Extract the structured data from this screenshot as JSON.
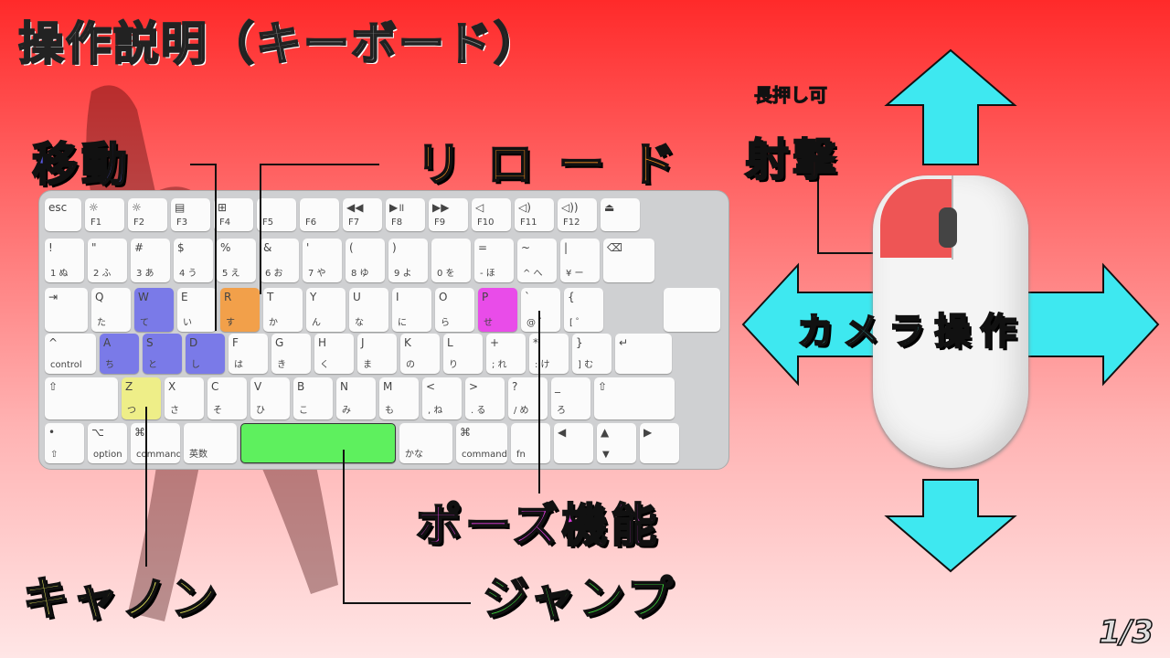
{
  "title": "操作説明（キーボード）",
  "labels": {
    "move": "移動",
    "reload": "リロード",
    "pause": "ポーズ機能",
    "cannon": "キャノン",
    "jump": "ジャンプ",
    "shoot": "射撃",
    "hold": "長押し可",
    "camera": "カメラ操作"
  },
  "page_indicator": "1/3",
  "colors": {
    "move": "#7a7ae8",
    "reload": "#f2a04a",
    "pause": "#e94ce9",
    "cannon": "#eeee88",
    "jump": "#5ef05e",
    "shoot": "#ee5555",
    "camera_arrows": "#3ee8f0"
  },
  "keyboard": {
    "row0": [
      {
        "main": "esc",
        "sub": ""
      },
      {
        "main": "☼",
        "sub": "F1"
      },
      {
        "main": "☼",
        "sub": "F2"
      },
      {
        "main": "▤",
        "sub": "F3"
      },
      {
        "main": "⊞",
        "sub": "F4"
      },
      {
        "main": "",
        "sub": "F5"
      },
      {
        "main": "",
        "sub": "F6"
      },
      {
        "main": "◀◀",
        "sub": "F7"
      },
      {
        "main": "▶॥",
        "sub": "F8"
      },
      {
        "main": "▶▶",
        "sub": "F9"
      },
      {
        "main": "◁",
        "sub": "F10"
      },
      {
        "main": "◁)",
        "sub": "F11"
      },
      {
        "main": "◁))",
        "sub": "F12"
      },
      {
        "main": "⏏",
        "sub": ""
      }
    ],
    "row1": [
      {
        "main": "!",
        "sub": "1 ぬ"
      },
      {
        "main": "\"",
        "sub": "2 ふ"
      },
      {
        "main": "#",
        "sub": "3 あ"
      },
      {
        "main": "$",
        "sub": "4 う"
      },
      {
        "main": "%",
        "sub": "5 え"
      },
      {
        "main": "&",
        "sub": "6 お"
      },
      {
        "main": "'",
        "sub": "7 や"
      },
      {
        "main": "(",
        "sub": "8 ゆ"
      },
      {
        "main": ")",
        "sub": "9 よ"
      },
      {
        "main": "",
        "sub": "0 を"
      },
      {
        "main": "=",
        "sub": "- ほ"
      },
      {
        "main": "~",
        "sub": "^ へ"
      },
      {
        "main": "|",
        "sub": "¥ ー"
      },
      {
        "main": "⌫",
        "sub": ""
      }
    ],
    "row2": [
      {
        "main": "⇥",
        "sub": ""
      },
      {
        "main": "Q",
        "sub": "た"
      },
      {
        "main": "W",
        "sub": "て"
      },
      {
        "main": "E",
        "sub": "い"
      },
      {
        "main": "R",
        "sub": "す"
      },
      {
        "main": "T",
        "sub": "か"
      },
      {
        "main": "Y",
        "sub": "ん"
      },
      {
        "main": "U",
        "sub": "な"
      },
      {
        "main": "I",
        "sub": "に"
      },
      {
        "main": "O",
        "sub": "ら"
      },
      {
        "main": "P",
        "sub": "せ"
      },
      {
        "main": "`",
        "sub": "@ ゛"
      },
      {
        "main": "{",
        "sub": "[ ゜"
      }
    ],
    "row3": [
      {
        "main": "^",
        "sub": "control"
      },
      {
        "main": "A",
        "sub": "ち"
      },
      {
        "main": "S",
        "sub": "と"
      },
      {
        "main": "D",
        "sub": "し"
      },
      {
        "main": "F",
        "sub": "は"
      },
      {
        "main": "G",
        "sub": "き"
      },
      {
        "main": "H",
        "sub": "く"
      },
      {
        "main": "J",
        "sub": "ま"
      },
      {
        "main": "K",
        "sub": "の"
      },
      {
        "main": "L",
        "sub": "り"
      },
      {
        "main": "+",
        "sub": "; れ"
      },
      {
        "main": "*",
        "sub": ": け"
      },
      {
        "main": "}",
        "sub": "] む"
      },
      {
        "main": "↵",
        "sub": ""
      }
    ],
    "row4": [
      {
        "main": "⇧",
        "sub": ""
      },
      {
        "main": "Z",
        "sub": "つ"
      },
      {
        "main": "X",
        "sub": "さ"
      },
      {
        "main": "C",
        "sub": "そ"
      },
      {
        "main": "V",
        "sub": "ひ"
      },
      {
        "main": "B",
        "sub": "こ"
      },
      {
        "main": "N",
        "sub": "み"
      },
      {
        "main": "M",
        "sub": "も"
      },
      {
        "main": "<",
        "sub": ", ね"
      },
      {
        "main": ">",
        "sub": ". る"
      },
      {
        "main": "?",
        "sub": "/ め"
      },
      {
        "main": "_",
        "sub": "ろ"
      },
      {
        "main": "⇧",
        "sub": ""
      }
    ],
    "row5": [
      {
        "main": "•",
        "sub": "⇧"
      },
      {
        "main": "⌥",
        "sub": "option"
      },
      {
        "main": "⌘",
        "sub": "command"
      },
      {
        "main": "",
        "sub": "英数"
      },
      {
        "main": "",
        "sub": ""
      },
      {
        "main": "",
        "sub": "かな"
      },
      {
        "main": "⌘",
        "sub": "command"
      },
      {
        "main": "",
        "sub": "fn"
      },
      {
        "main": "◀",
        "sub": ""
      },
      {
        "main": "▲",
        "sub": "▼"
      },
      {
        "main": "▶",
        "sub": ""
      }
    ]
  }
}
